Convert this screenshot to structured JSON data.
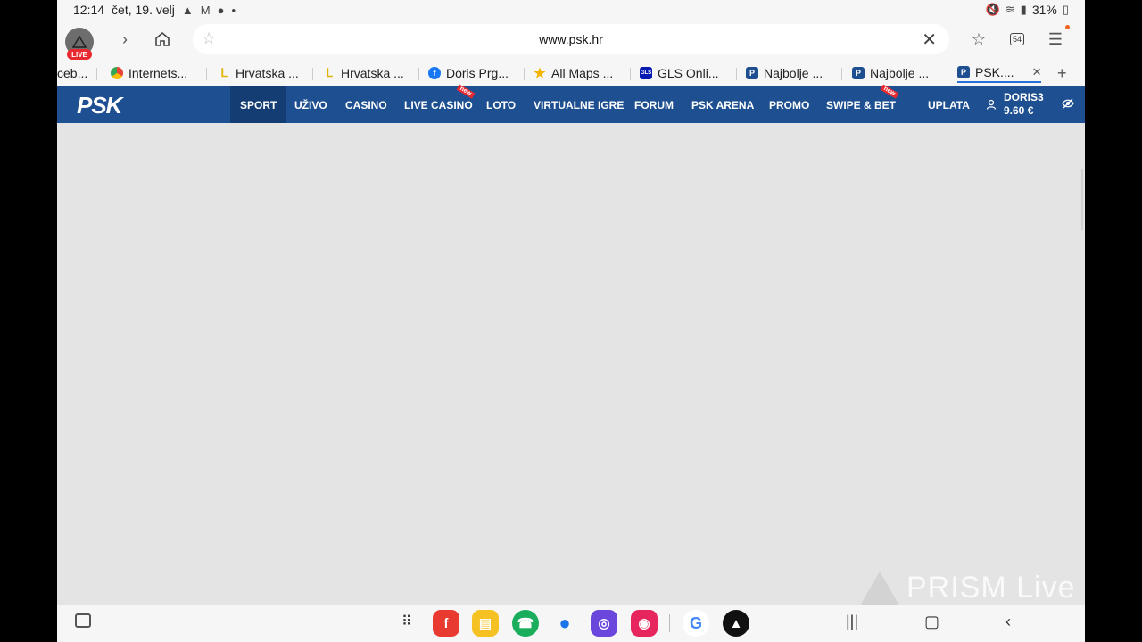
{
  "status_bar": {
    "time": "12:14",
    "date": "čet, 19. velj",
    "battery": "31%"
  },
  "browser": {
    "live_badge": "LIVE",
    "url": "www.psk.hr",
    "tab_count": "54"
  },
  "tabs": [
    {
      "label": "ceb...",
      "favicon": "none"
    },
    {
      "label": "Internets...",
      "favicon": "chrome-icon"
    },
    {
      "label": "Hrvatska ...",
      "favicon": "yellow-icon"
    },
    {
      "label": "Hrvatska ...",
      "favicon": "yellow-icon"
    },
    {
      "label": "Doris Prg...",
      "favicon": "facebook-icon"
    },
    {
      "label": "All Maps ...",
      "favicon": "star-icon"
    },
    {
      "label": "GLS Onli...",
      "favicon": "gls-icon"
    },
    {
      "label": "Najbolje ...",
      "favicon": "psk-icon"
    },
    {
      "label": "Najbolje ...",
      "favicon": "psk-icon"
    },
    {
      "label": "PSK....",
      "favicon": "psk-icon",
      "active": true
    }
  ],
  "site": {
    "logo": "PSK",
    "nav": [
      {
        "label": "SPORT",
        "active": true
      },
      {
        "label": "UŽIVO"
      },
      {
        "label": "CASINO"
      },
      {
        "label": "LIVE CASINO",
        "badge": "new"
      },
      {
        "label": "LOTO"
      },
      {
        "label": "VIRTUALNE IGRE"
      },
      {
        "label": "FORUM"
      },
      {
        "label": "PSK ARENA"
      },
      {
        "label": "PROMO"
      },
      {
        "label": "SWIPE & BET",
        "badge": "new"
      },
      {
        "label": "UPLATA"
      }
    ],
    "user": {
      "name": "DORIS3",
      "balance": "9.60 €"
    }
  },
  "watermark": "PRISM Live",
  "colors": {
    "nav_bg": "#1d4f91",
    "nav_active": "#143d73",
    "content_bg": "#e4e4e5",
    "live_red": "#e8292f"
  }
}
